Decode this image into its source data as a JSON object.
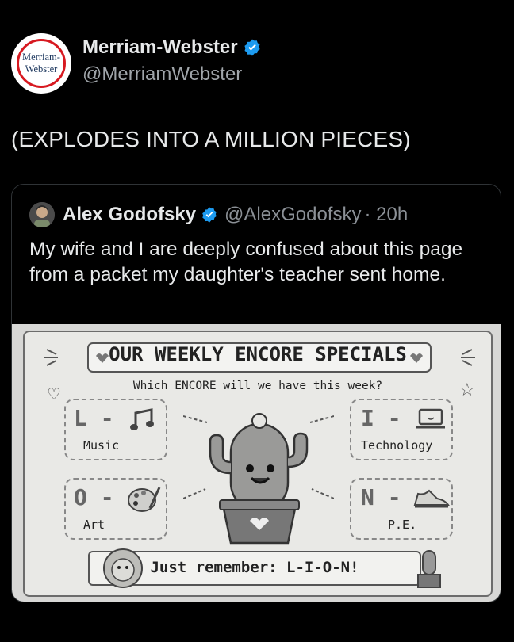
{
  "author": {
    "display_name": "Merriam-Webster",
    "handle": "@MerriamWebster",
    "logo_line1": "Merriam-",
    "logo_line2": "Webster"
  },
  "tweet": {
    "text": "(EXPLODES INTO A MILLION PIECES)"
  },
  "quoted": {
    "display_name": "Alex Godofsky",
    "handle": "@AlexGodofsky",
    "time": "· 20h",
    "text": "My wife and I are deeply confused about this page from a packet my daughter's teacher sent home."
  },
  "worksheet": {
    "title": "OUR WEEKLY ENCORE SPECIALS",
    "subtitle": "Which ENCORE will we have this week?",
    "tiles": [
      {
        "letter": "L -",
        "label": "Music",
        "icon": "music-note-icon"
      },
      {
        "letter": "I -",
        "label": "Technology",
        "icon": "laptop-icon"
      },
      {
        "letter": "O -",
        "label": "Art",
        "icon": "palette-icon"
      },
      {
        "letter": "N -",
        "label": "P.E.",
        "icon": "sneaker-icon"
      }
    ],
    "remember": "Just remember: L-I-O-N!"
  },
  "colors": {
    "verified": "#1d9bf0",
    "background": "#000000",
    "text": "#e7e9ea",
    "muted": "#8b9096"
  }
}
